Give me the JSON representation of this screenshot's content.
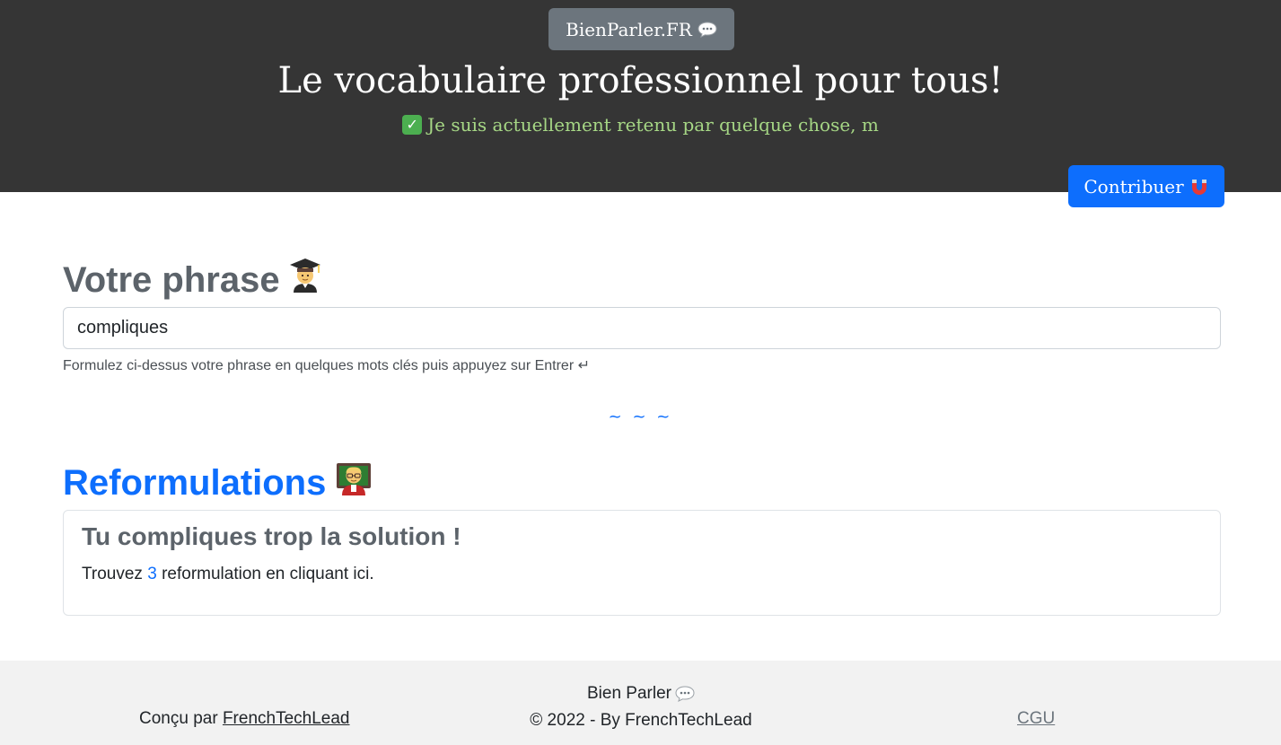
{
  "header": {
    "brand_label": "BienParler.FR",
    "brand_icon": "speech-bubble-icon",
    "title": "Le vocabulaire professionnel pour tous!",
    "status_icon": "check-mark-icon",
    "status_text": "Je suis actuellement retenu par quelque chose, m",
    "contribute_label": "Contribuer",
    "contribute_icon": "magnet-icon"
  },
  "phrase_section": {
    "title": "Votre phrase",
    "title_icon": "graduate-student-icon",
    "input_value": "compliques",
    "help_text": "Formulez ci-dessus votre phrase en quelques mots clés puis appuyez sur Entrer ↵"
  },
  "separator": "~ ~ ~",
  "reformulations": {
    "title": "Reformulations",
    "title_icon": "teacher-icon",
    "result": {
      "heading": "Tu compliques trop la solution !",
      "prefix": "Trouvez",
      "count": "3",
      "suffix": "reformulation en cliquant ici."
    }
  },
  "footer": {
    "designed_by_prefix": "Conçu par",
    "designed_by_link": "FrenchTechLead",
    "brand": "Bien Parler",
    "brand_icon": "speech-bubble-icon",
    "copyright": "© 2022 - By FrenchTechLead",
    "cgu_link": "CGU"
  },
  "colors": {
    "header_bg": "#353535",
    "accent": "#0d6efd",
    "status_text": "#a6d785",
    "badge_bg": "#6c757d",
    "footer_bg": "#f2f2f2"
  }
}
